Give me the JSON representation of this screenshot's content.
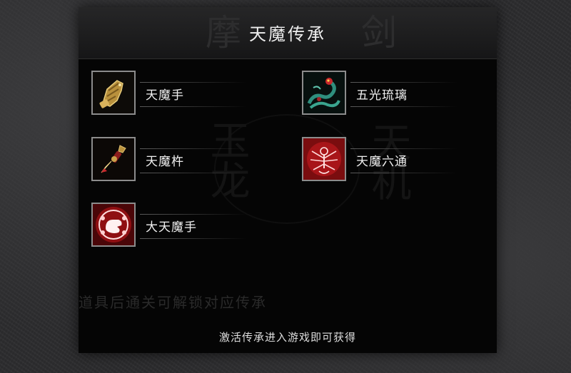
{
  "modal": {
    "title": "天魔传承",
    "header_ghost_left": "摩",
    "header_ghost_right": "剑",
    "background_ghost_a": "玉龙",
    "background_ghost_b": "天机"
  },
  "items": [
    {
      "label": "天魔手",
      "icon": "golden-gauntlet-icon"
    },
    {
      "label": "五光琉璃",
      "icon": "serpent-relic-icon"
    },
    {
      "label": "天魔杵",
      "icon": "vajra-pestle-icon"
    },
    {
      "label": "天魔六通",
      "icon": "multi-armed-deity-icon"
    },
    {
      "label": "大天魔手",
      "icon": "demon-hand-seal-icon"
    }
  ],
  "hint_text": "道具后通关可解锁对应传承",
  "footer_text": "激活传承进入游戏即可获得",
  "colors": {
    "panel_bg": "#050505",
    "header_bg": "#1e1e1f",
    "text_primary": "#f0f0f0",
    "frame_border": "#8c8c8c",
    "accent_red": "#c8282d",
    "accent_gold": "#c9a14a",
    "accent_teal": "#2f8f7e"
  }
}
